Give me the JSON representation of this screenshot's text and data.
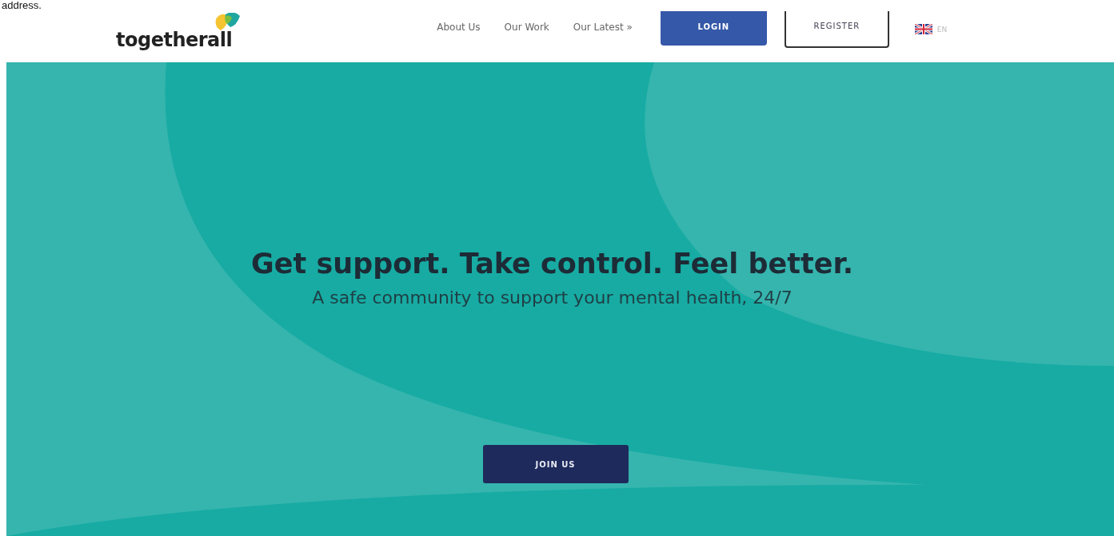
{
  "caption_fragment": "address.",
  "header": {
    "logo": "togetherall",
    "nav": [
      {
        "label": "About Us"
      },
      {
        "label": "Our Work"
      },
      {
        "label": "Our Latest »"
      }
    ],
    "login": "LOGIN",
    "register": "REGISTER",
    "language": "EN"
  },
  "hero": {
    "title": "Get support. Take control. Feel better.",
    "subtitle": "A safe community to support your mental health, 24/7",
    "cta": "JOIN US"
  }
}
